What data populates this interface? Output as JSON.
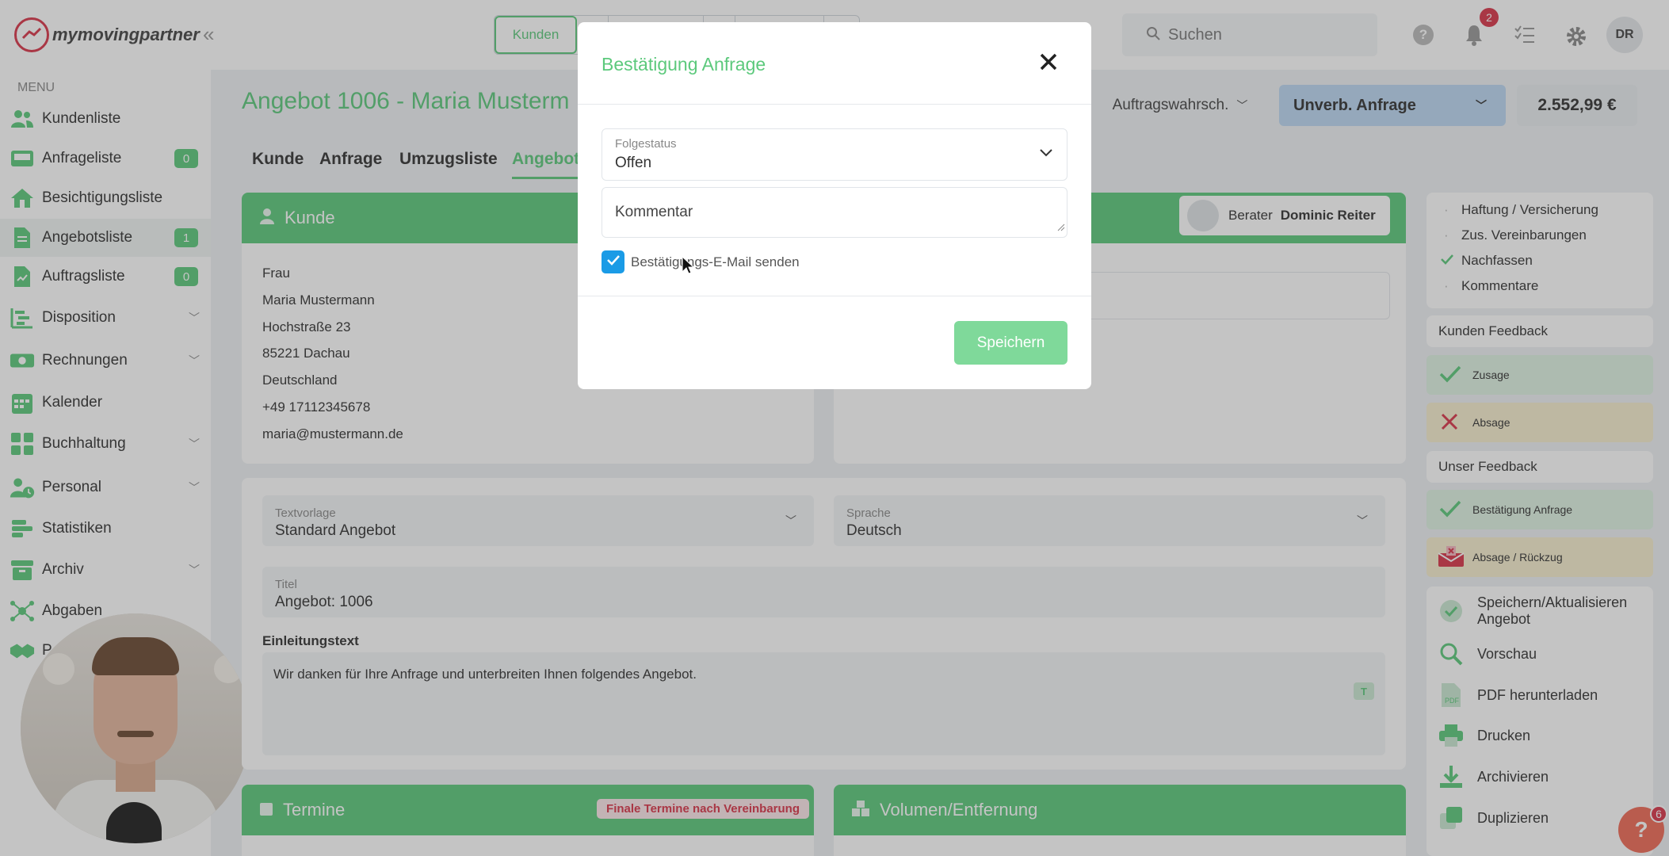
{
  "brand": {
    "logo_text": "mymovingpartner"
  },
  "topbar": {
    "tab_active": "Kunden",
    "search_placeholder": "Suchen",
    "notification_count": "2",
    "user_initials": "DR"
  },
  "sidebar": {
    "menu_label": "MENU",
    "items": [
      {
        "label": "Kundenliste",
        "badge": ""
      },
      {
        "label": "Anfrageliste",
        "badge": "0"
      },
      {
        "label": "Besichtigungsliste",
        "badge": ""
      },
      {
        "label": "Angebotsliste",
        "badge": "1"
      },
      {
        "label": "Auftragsliste",
        "badge": "0"
      },
      {
        "label": "Disposition",
        "badge": ""
      },
      {
        "label": "Rechnungen",
        "badge": ""
      },
      {
        "label": "Kalender",
        "badge": ""
      },
      {
        "label": "Buchhaltung",
        "badge": ""
      },
      {
        "label": "Personal",
        "badge": ""
      },
      {
        "label": "Statistiken",
        "badge": ""
      },
      {
        "label": "Archiv",
        "badge": ""
      },
      {
        "label": "Abgaben",
        "badge": ""
      },
      {
        "label": "P",
        "badge": ""
      }
    ]
  },
  "header": {
    "title": "Angebot 1006 - Maria Musterm",
    "probability_label": "Auftragswahrsch.",
    "status_label": "Unverb. Anfrage",
    "price": "2.552,99 €"
  },
  "tabs": [
    "Kunde",
    "Anfrage",
    "Umzugsliste",
    "Angebot"
  ],
  "kunde_card": {
    "title": "Kunde",
    "lines": [
      "Frau",
      "Maria Mustermann",
      "Hochstraße 23",
      "85221 Dachau",
      "Deutschland",
      "+49 17112345678",
      "maria@mustermann.de"
    ]
  },
  "berater": {
    "label": "Berater",
    "name": "Dominic Reiter"
  },
  "form": {
    "textvorlage_label": "Textvorlage",
    "textvorlage_value": "Standard Angebot",
    "sprache_label": "Sprache",
    "sprache_value": "Deutsch",
    "titel_label": "Titel",
    "titel_value": "Angebot: 1006",
    "einleitung_label": "Einleitungstext",
    "einleitung_value": "Wir danken für Ihre Anfrage und unterbreiten Ihnen folgendes Angebot."
  },
  "bottom_cards": {
    "termine_title": "Termine",
    "termine_badge": "Finale Termine nach Vereinbarung",
    "volumen_title": "Volumen/Entfernung"
  },
  "right_panel": {
    "checklist": [
      {
        "label": "Haftung / Versicherung",
        "done": false
      },
      {
        "label": "Zus. Vereinbarungen",
        "done": false
      },
      {
        "label": "Nachfassen",
        "done": true
      },
      {
        "label": "Kommentare",
        "done": false
      }
    ],
    "kunden_feedback_title": "Kunden Feedback",
    "zusage_label": "Zusage",
    "absage_label": "Absage",
    "unser_feedback_title": "Unser Feedback",
    "bestaetigung_label": "Bestätigung Anfrage",
    "absage_rueckzug_label": "Absage / Rückzug",
    "actions": [
      "Speichern/Aktualisieren Angebot",
      "Vorschau",
      "PDF herunterladen",
      "Drucken",
      "Archivieren",
      "Duplizieren"
    ]
  },
  "help": {
    "count": "6",
    "glyph": "?"
  },
  "modal": {
    "title": "Bestätigung Anfrage",
    "folgestatus_label": "Folgestatus",
    "folgestatus_value": "Offen",
    "kommentar_placeholder": "Kommentar",
    "checkbox_label": "Bestätigungs-E-Mail senden",
    "checkbox_checked": true,
    "save_label": "Speichern"
  },
  "colors": {
    "brand_green": "#5cc97c",
    "status_blue": "#bcd7f2",
    "checkbox_blue": "#1a9be6",
    "feedback_green": "#dff2e3",
    "feedback_yellow": "#f6eecf",
    "danger_red": "#d9354a"
  }
}
